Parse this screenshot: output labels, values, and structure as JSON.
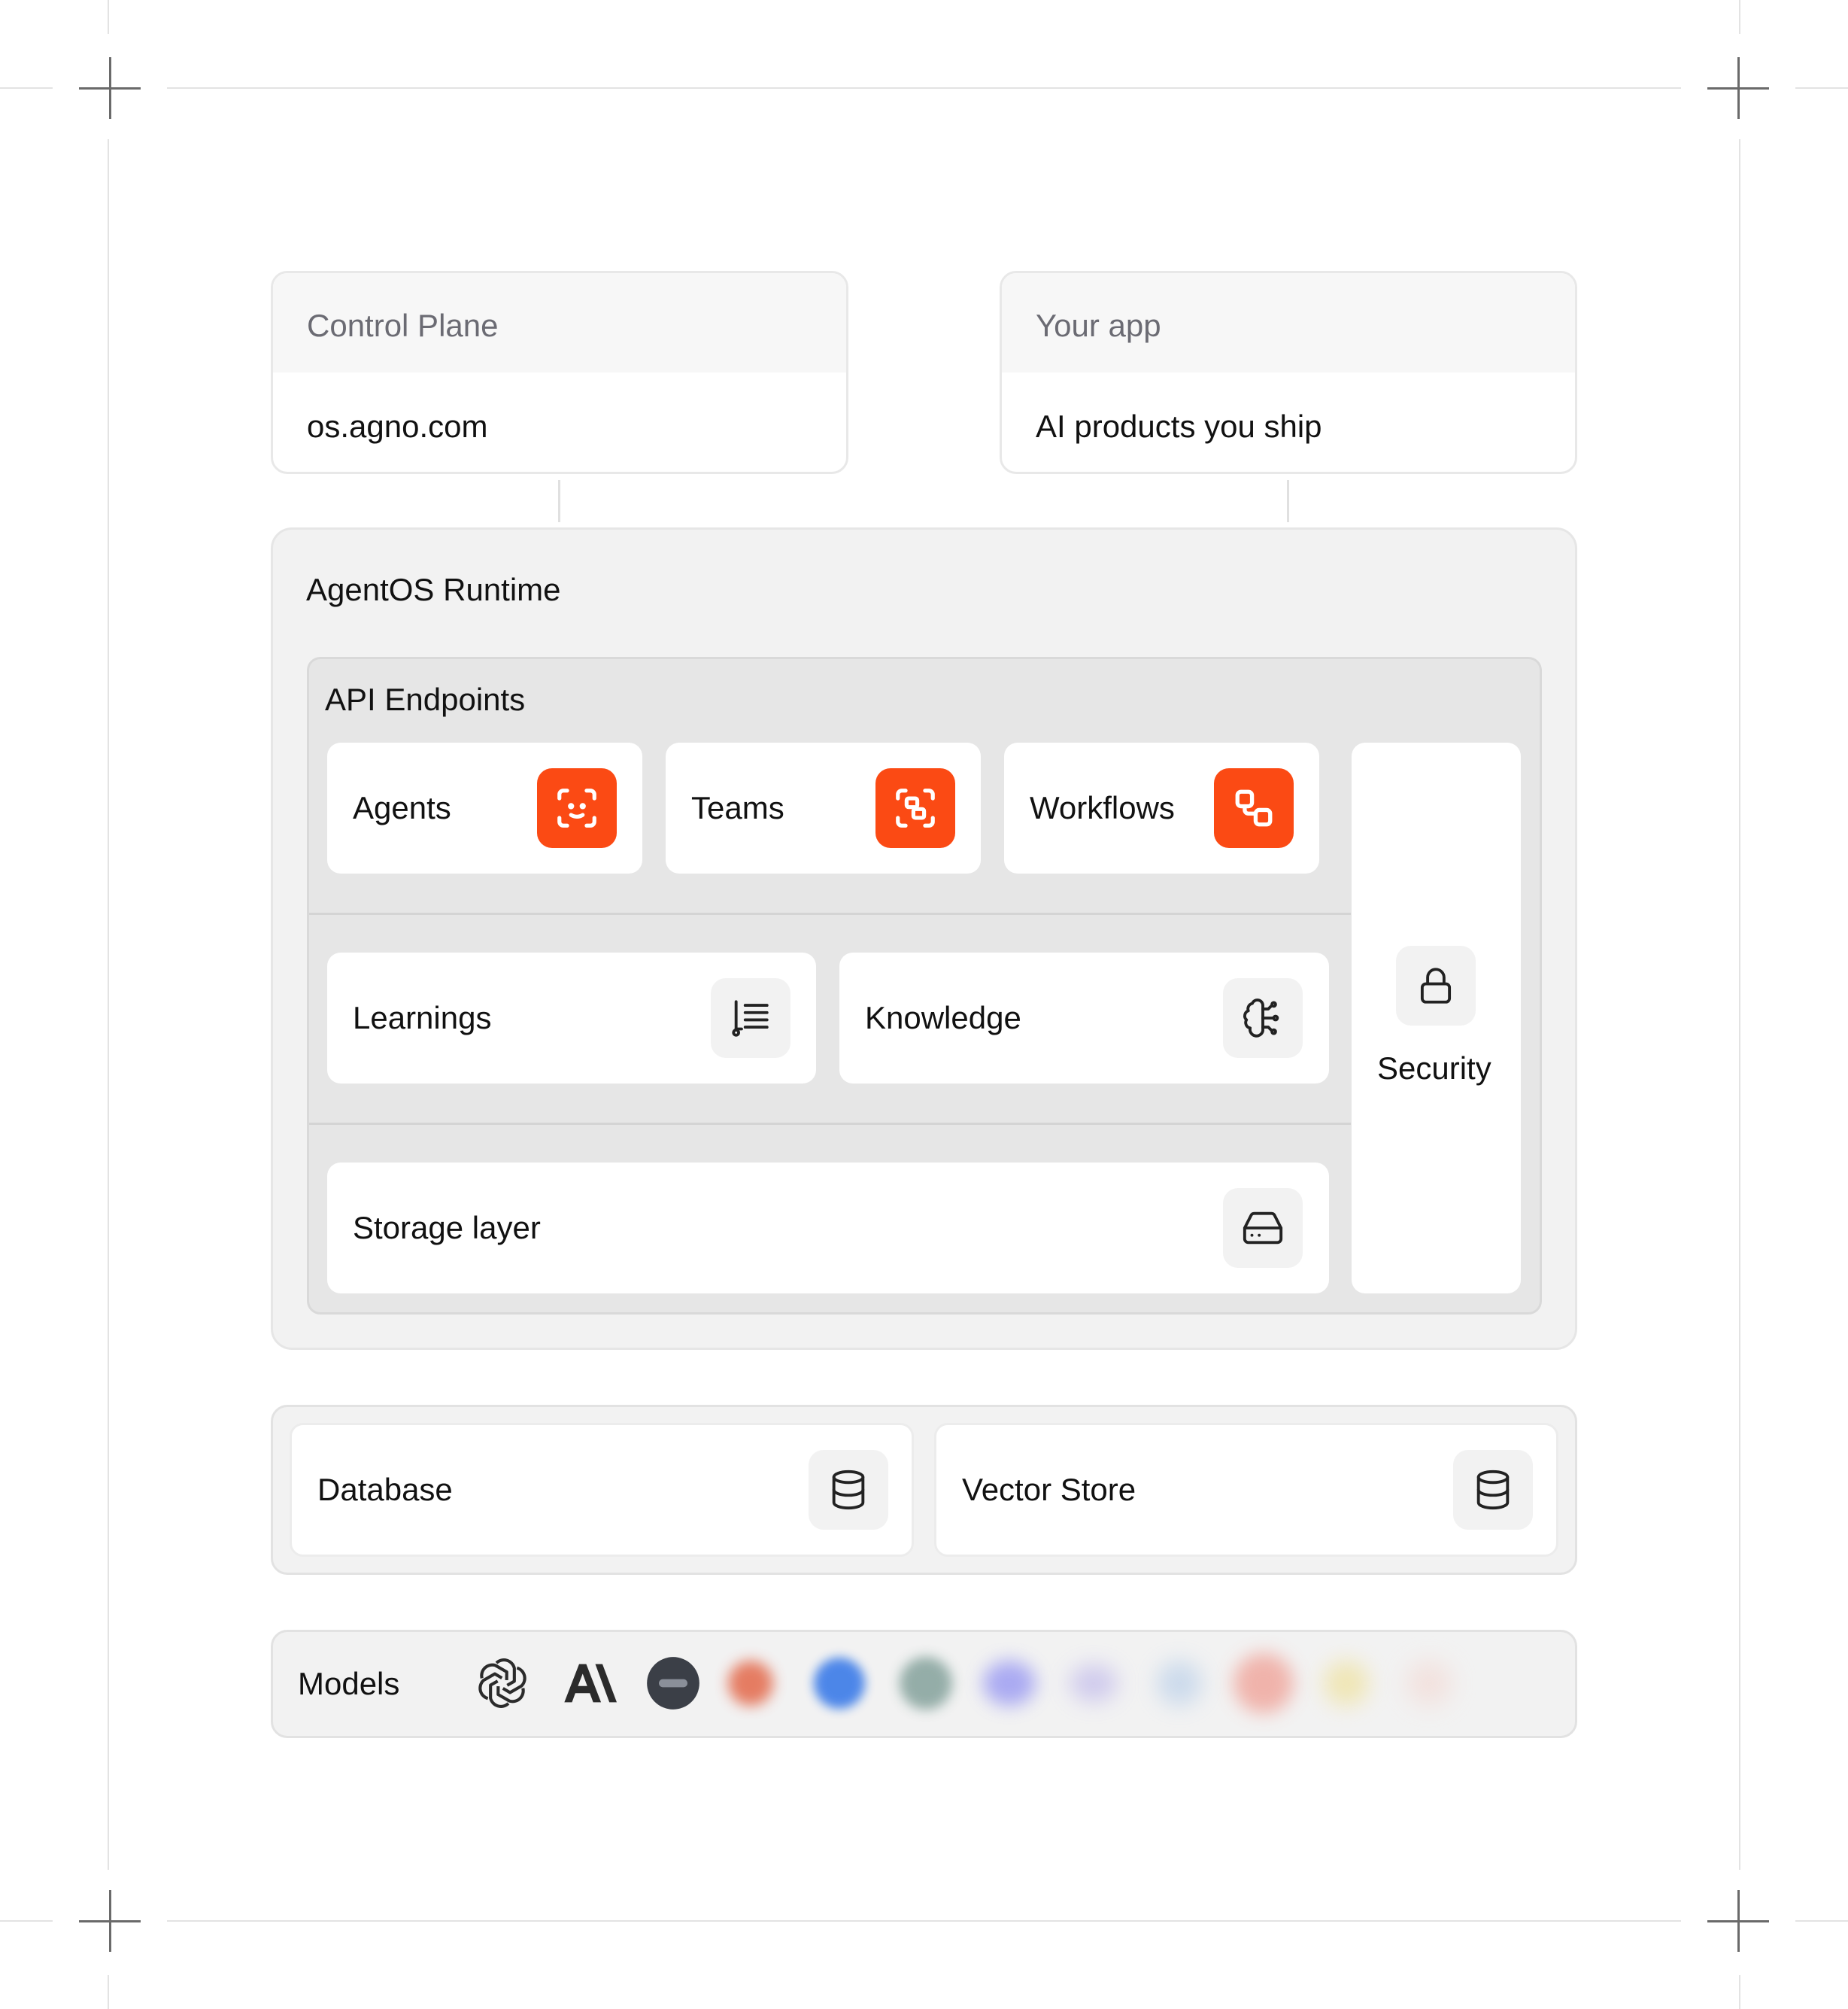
{
  "top_cards": [
    {
      "heading": "Control Plane",
      "value": "os.agno.com"
    },
    {
      "heading": "Your app",
      "value": "AI products you ship"
    }
  ],
  "runtime": {
    "title": "AgentOS Runtime",
    "api_title": "API Endpoints",
    "endpoints": [
      {
        "label": "Agents",
        "icon": "agent-scan-icon"
      },
      {
        "label": "Teams",
        "icon": "team-scan-icon"
      },
      {
        "label": "Workflows",
        "icon": "workflow-icon"
      }
    ],
    "learnings": {
      "label": "Learnings",
      "icon": "list-tree-icon"
    },
    "knowledge": {
      "label": "Knowledge",
      "icon": "brain-circuit-icon"
    },
    "storage": {
      "label": "Storage layer",
      "icon": "hard-drive-icon"
    },
    "security": {
      "label": "Security",
      "icon": "lock-icon"
    }
  },
  "datastores": [
    {
      "label": "Database",
      "icon": "database-icon"
    },
    {
      "label": "Vector Store",
      "icon": "database-icon"
    }
  ],
  "models": {
    "label": "Models",
    "logos": [
      "openai-logo",
      "anthropic-logo",
      "model-logo-3",
      "model-logo-4",
      "model-logo-5",
      "model-logo-6",
      "model-logo-7",
      "model-logo-8",
      "model-logo-9",
      "model-logo-10",
      "model-logo-11",
      "model-logo-12"
    ]
  },
  "colors": {
    "accent": "#fb4a14",
    "panel": "#f2f2f2",
    "inner_panel": "#e6e6e6"
  }
}
